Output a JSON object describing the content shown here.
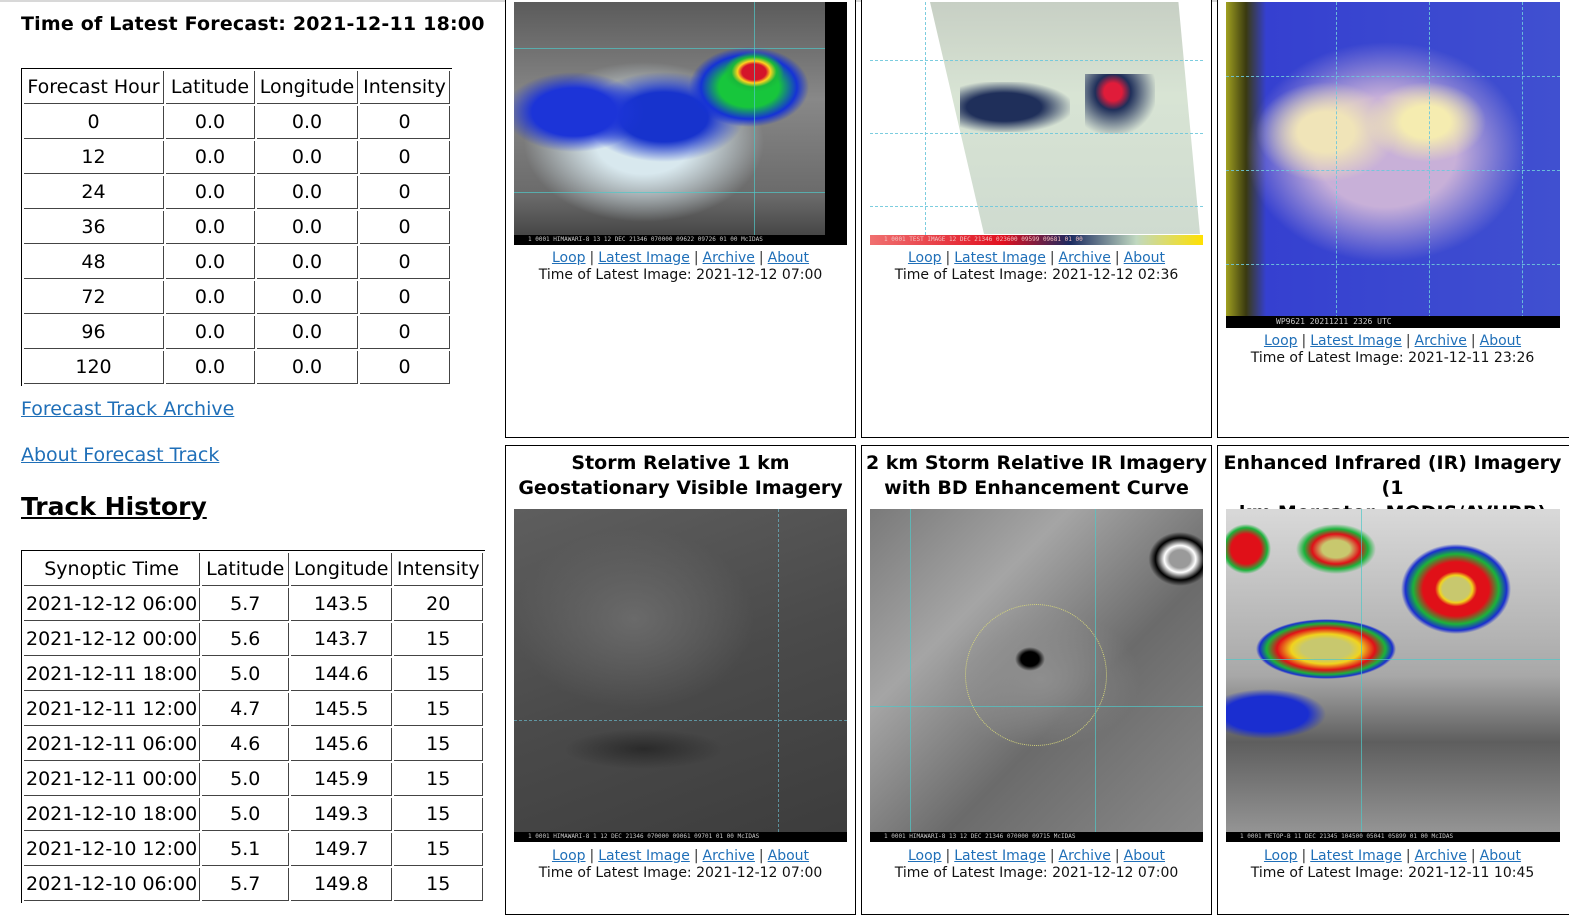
{
  "forecast": {
    "title": "Time of Latest Forecast: 2021-12-11 18:00",
    "columns": [
      "Forecast Hour",
      "Latitude",
      "Longitude",
      "Intensity"
    ],
    "rows": [
      [
        "0",
        "0.0",
        "0.0",
        "0"
      ],
      [
        "12",
        "0.0",
        "0.0",
        "0"
      ],
      [
        "24",
        "0.0",
        "0.0",
        "0"
      ],
      [
        "36",
        "0.0",
        "0.0",
        "0"
      ],
      [
        "48",
        "0.0",
        "0.0",
        "0"
      ],
      [
        "72",
        "0.0",
        "0.0",
        "0"
      ],
      [
        "96",
        "0.0",
        "0.0",
        "0"
      ],
      [
        "120",
        "0.0",
        "0.0",
        "0"
      ]
    ],
    "archive_link": "Forecast Track Archive",
    "about_link": "About Forecast Track"
  },
  "track_history": {
    "title": "Track History",
    "columns": [
      "Synoptic Time",
      "Latitude",
      "Longitude",
      "Intensity"
    ],
    "rows": [
      [
        "2021-12-12 06:00",
        "5.7",
        "143.5",
        "20"
      ],
      [
        "2021-12-12 00:00",
        "5.6",
        "143.7",
        "15"
      ],
      [
        "2021-12-11 18:00",
        "5.0",
        "144.6",
        "15"
      ],
      [
        "2021-12-11 12:00",
        "4.7",
        "145.5",
        "15"
      ],
      [
        "2021-12-11 06:00",
        "4.6",
        "145.6",
        "15"
      ],
      [
        "2021-12-11 00:00",
        "5.0",
        "145.9",
        "15"
      ],
      [
        "2021-12-10 18:00",
        "5.0",
        "149.3",
        "15"
      ],
      [
        "2021-12-10 12:00",
        "5.1",
        "149.7",
        "15"
      ],
      [
        "2021-12-10 06:00",
        "5.7",
        "149.8",
        "15"
      ]
    ]
  },
  "link_labels": {
    "loop": "Loop",
    "latest": "Latest Image",
    "archive": "Archive",
    "about": "About",
    "sep": "|"
  },
  "panels": [
    {
      "title": "",
      "time": "Time of Latest Image: 2021-12-12 07:00",
      "strip": "1 0001 HIMAWARI-8 13 12 DEC 21346 070000 09622 09726 01 00   McIDAS"
    },
    {
      "title": "",
      "time": "Time of Latest Image: 2021-12-12 02:36",
      "strip": "1 0001 TEST IMAGE   12 DEC 21346 023600 09599 09681 01 00"
    },
    {
      "title": "",
      "time": "Time of Latest Image: 2021-12-11 23:26",
      "strip": "WP9621  20211211  2326 UTC"
    },
    {
      "title_line1": "Storm Relative 1 km",
      "title_line2": "Geostationary Visible Imagery",
      "time": "Time of Latest Image: 2021-12-12 07:00",
      "strip": "1 0001 HIMAWARI-8  1 12 DEC 21346 070000 09061 09701 01 00 McIDAS"
    },
    {
      "title_line1": "2 km Storm Relative IR Imagery",
      "title_line2": "with BD Enhancement Curve",
      "time": "Time of Latest Image: 2021-12-12 07:00",
      "strip": "1 0001 HIMAWARI-8 13 12 DEC 21346 070000 09715 McIDAS"
    },
    {
      "title_line1": "Enhanced Infrared (IR) Imagery (1",
      "title_line2": "km Mercator, MODIS/AVHRR)",
      "time": "Time of Latest Image: 2021-12-11 10:45",
      "strip": "1 0001 METOP-B   11 DEC 21345 104500 05041 05899 01 00   McIDAS"
    }
  ]
}
